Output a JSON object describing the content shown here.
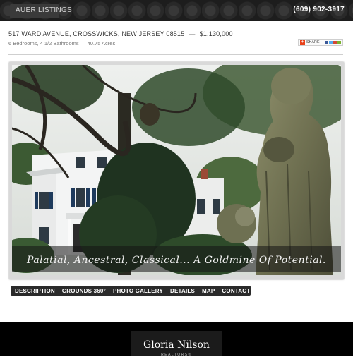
{
  "header": {
    "brand": "AUER LISTINGS",
    "phone": "(609) 902-3917"
  },
  "listing": {
    "address": "517 WARD AVENUE, CROSSWICKS, NEW JERSEY 08515",
    "separator": "—",
    "price": "$1,130,000",
    "beds_baths": "6 Bedrooms, 4 1/2 Bathrooms",
    "acres": "40.75 Acres"
  },
  "share": {
    "label": "SHARE"
  },
  "hero": {
    "caption": "Palatial, Ancestral, Classical... A Goldmine Of Potential."
  },
  "nav": {
    "items": [
      "DESCRIPTION",
      "GROUNDS 360°",
      "PHOTO GALLERY",
      "DETAILS",
      "MAP",
      "CONTACT"
    ]
  },
  "footer": {
    "logo_name": "Gloria Nilson",
    "logo_sub": "REALTORS®"
  },
  "colors": {
    "header_bg": "#1d1d1d",
    "footer_bg": "#000000",
    "nav_bg": "#2a2a2a"
  }
}
